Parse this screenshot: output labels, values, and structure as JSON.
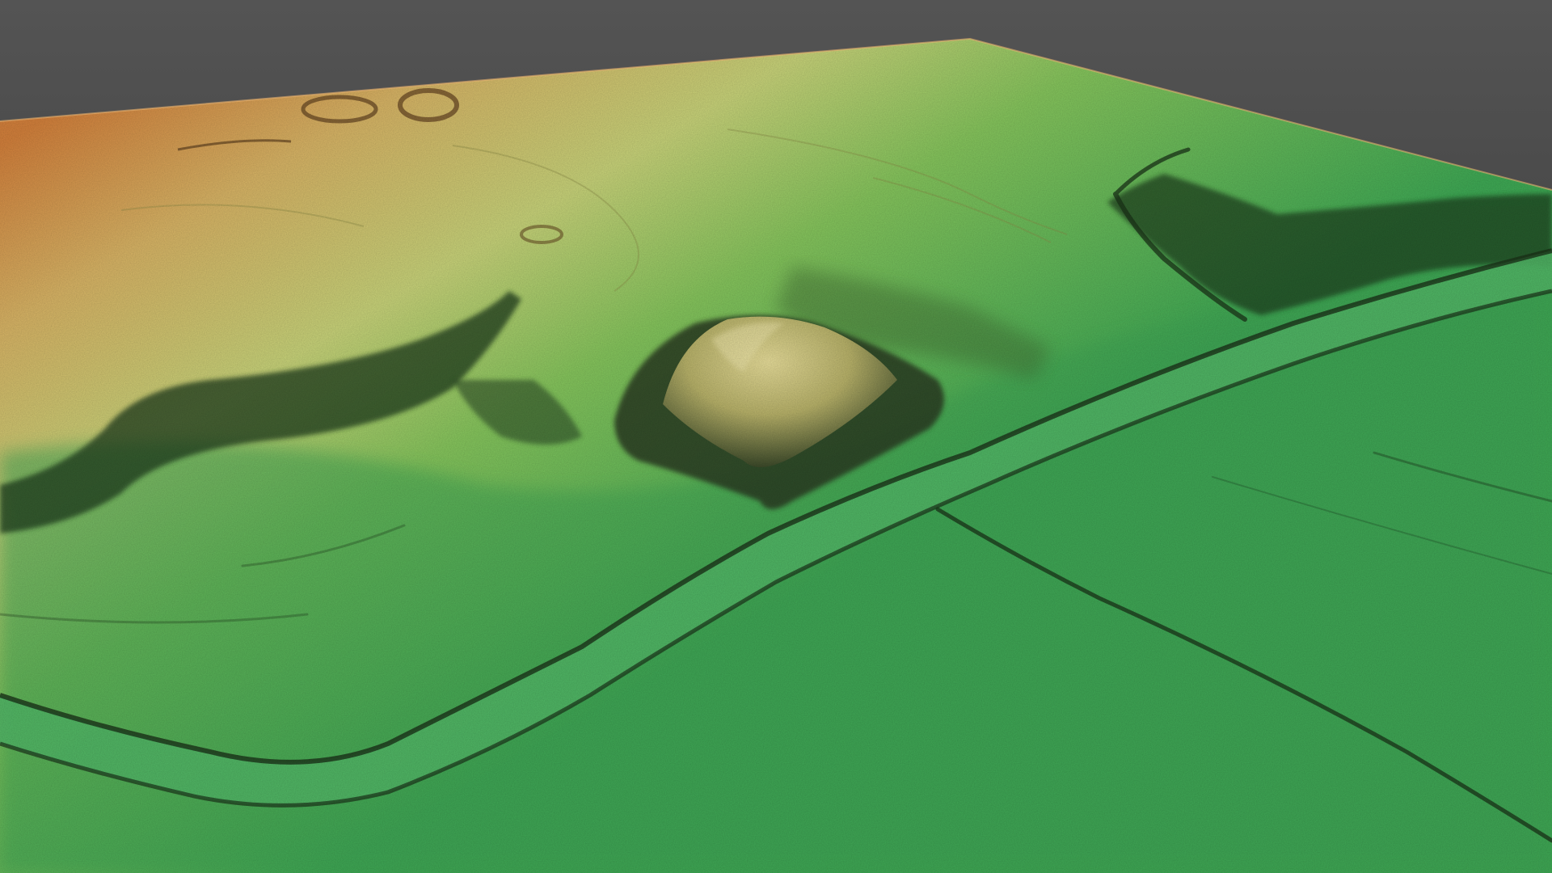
{
  "scene": {
    "type": "shaded-relief-elevation-model",
    "view": "oblique-3d",
    "colors": {
      "background_top": "#545454",
      "background_bottom": "#2a2a2a",
      "elevation_high": "#d4813c",
      "elevation_upper_mid": "#d9b566",
      "elevation_mid": "#c9d47a",
      "elevation_lower_mid": "#86c65d",
      "elevation_low": "#3faa55",
      "shadow": "#1e3a1f"
    },
    "features": [
      {
        "name": "central-mound",
        "kind": "hill"
      },
      {
        "name": "river-channel",
        "kind": "channel"
      },
      {
        "name": "western-escarpment",
        "kind": "terrace-edge"
      },
      {
        "name": "eastern-escarpment",
        "kind": "terrace-edge"
      },
      {
        "name": "northern-ring-features",
        "kind": "earthwork"
      },
      {
        "name": "field-boundary-lines",
        "kind": "linear-feature"
      }
    ]
  }
}
